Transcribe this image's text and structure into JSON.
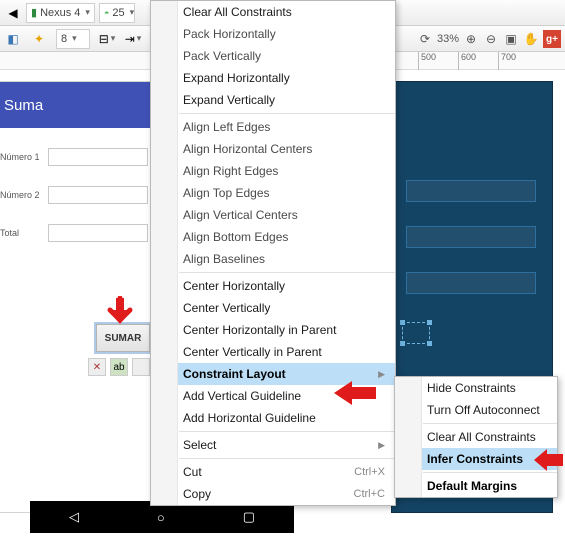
{
  "toolbar": {
    "device_label": "Nexus 4",
    "api_label": "25",
    "zoom_label": "33%",
    "spacing_value": "8"
  },
  "ruler": {
    "ticks": [
      {
        "pos": 0,
        "label": ""
      },
      {
        "pos": 80,
        "label": ""
      },
      {
        "pos": 418,
        "label": "500"
      },
      {
        "pos": 458,
        "label": "600"
      },
      {
        "pos": 498,
        "label": "700"
      }
    ]
  },
  "preview": {
    "app_title": "Suma",
    "label1": "Número 1",
    "label2": "Número 2",
    "label3": "Total",
    "button_label": "SUMAR"
  },
  "menu": {
    "items": [
      {
        "icon": "✕",
        "label": "Clear All Constraints",
        "interact": true,
        "dark": true
      },
      {
        "icon": "⇥",
        "label": "Pack Horizontally",
        "interact": true
      },
      {
        "icon": "⇵",
        "label": "Pack Vertically",
        "interact": true
      },
      {
        "icon": "↔",
        "label": "Expand Horizontally",
        "interact": true,
        "dark": true
      },
      {
        "icon": "↕",
        "label": "Expand Vertically",
        "interact": true,
        "dark": true
      },
      {
        "sep": true
      },
      {
        "icon": "⊏",
        "label": "Align Left Edges",
        "interact": true
      },
      {
        "icon": "⊟",
        "label": "Align Horizontal Centers",
        "interact": true
      },
      {
        "icon": "⊐",
        "label": "Align Right Edges",
        "interact": true
      },
      {
        "icon": "⊤",
        "label": "Align Top Edges",
        "interact": true
      },
      {
        "icon": "╫",
        "label": "Align Vertical Centers",
        "interact": true
      },
      {
        "icon": "⊥",
        "label": "Align Bottom Edges",
        "interact": true
      },
      {
        "icon": "≣",
        "label": "Align Baselines",
        "interact": true
      },
      {
        "sep": true
      },
      {
        "icon": "↔",
        "label": "Center Horizontally",
        "interact": true,
        "dark": true
      },
      {
        "icon": "↕",
        "label": "Center Vertically",
        "interact": true,
        "dark": true
      },
      {
        "icon": "⇔",
        "label": "Center Horizontally in Parent",
        "interact": true,
        "dark": true
      },
      {
        "icon": "⇕",
        "label": "Center Vertically in Parent",
        "interact": true,
        "dark": true
      },
      {
        "icon": "",
        "label": "Constraint Layout",
        "interact": true,
        "dark": true,
        "highlight": true,
        "submenu": true
      },
      {
        "icon": "┊",
        "label": "Add Vertical Guideline",
        "interact": true,
        "dark": true
      },
      {
        "icon": "┄",
        "label": "Add Horizontal Guideline",
        "interact": true,
        "dark": true
      },
      {
        "sep": true
      },
      {
        "icon": "",
        "label": "Select",
        "interact": true,
        "dark": true,
        "submenu": true
      },
      {
        "sep": true
      },
      {
        "icon": "✂",
        "label": "Cut",
        "shortcut": "Ctrl+X",
        "interact": true,
        "dark": true
      },
      {
        "icon": "⧉",
        "label": "Copy",
        "shortcut": "Ctrl+C",
        "interact": true,
        "dark": true
      }
    ]
  },
  "submenu": {
    "items": [
      {
        "icon": "👁",
        "label": "Hide Constraints",
        "interact": true
      },
      {
        "icon": "⧲",
        "label": "Turn Off Autoconnect",
        "interact": true
      },
      {
        "sep": true
      },
      {
        "icon": "✕",
        "label": "Clear All Constraints",
        "interact": true
      },
      {
        "icon": "✦",
        "label": "Infer Constraints",
        "interact": true,
        "highlight": true,
        "bold": true,
        "iconcolor": "#e8a300"
      },
      {
        "sep": true
      },
      {
        "icon": "8",
        "label": "Default Margins",
        "interact": true,
        "bold": true
      }
    ]
  }
}
